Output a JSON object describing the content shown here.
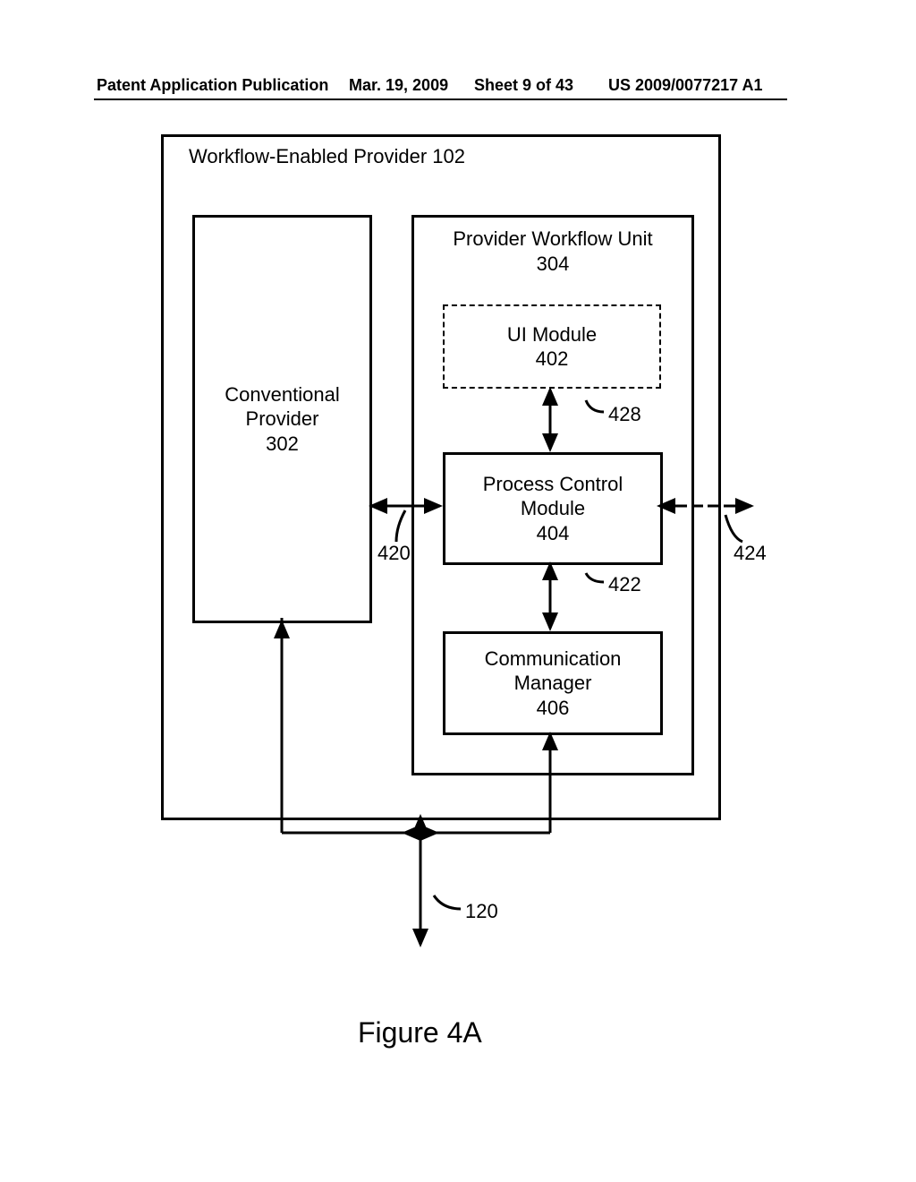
{
  "header": {
    "left": "Patent Application Publication",
    "date": "Mar. 19, 2009",
    "sheet": "Sheet 9 of 43",
    "pubno": "US 2009/0077217 A1"
  },
  "figure_caption": "Figure 4A",
  "boxes": {
    "outer_title": "Workflow-Enabled Provider 102",
    "conventional_l1": "Conventional",
    "conventional_l2": "Provider",
    "conventional_l3": "302",
    "wfunit_l1": "Provider Workflow Unit",
    "wfunit_l2": "304",
    "uimod_l1": "UI Module",
    "uimod_l2": "402",
    "pcm_l1": "Process Control",
    "pcm_l2": "Module",
    "pcm_l3": "404",
    "comm_l1": "Communication",
    "comm_l2": "Manager",
    "comm_l3": "406"
  },
  "refs": {
    "r428": "428",
    "r420": "420",
    "r422": "422",
    "r424": "424",
    "r120": "120"
  }
}
